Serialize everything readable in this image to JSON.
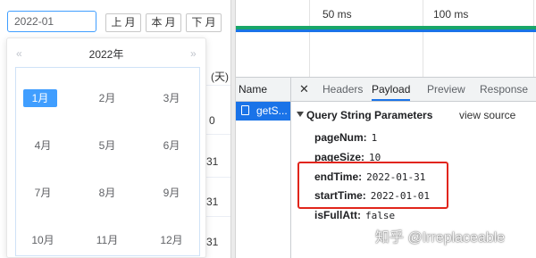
{
  "month_filter": {
    "value": "2022-01",
    "prev_month_label": "上 月",
    "this_month_label": "本 月",
    "next_month_label": "下 月"
  },
  "month_picker": {
    "prev_year_glyph": "«",
    "next_year_glyph": "»",
    "year_label": "2022年",
    "selected": "1月",
    "months": [
      "1月",
      "2月",
      "3月",
      "4月",
      "5月",
      "6月",
      "7月",
      "8月",
      "9月",
      "10月",
      "11月",
      "12月"
    ]
  },
  "background_table": {
    "header_partial": "(天)",
    "cells_partial": [
      "0",
      "31",
      "31",
      "31",
      "31"
    ]
  },
  "devtools": {
    "timeline_ticks": [
      "50 ms",
      "100 ms"
    ],
    "name_header": "Name",
    "request_name": "getS...",
    "close_glyph": "✕",
    "tabs": [
      "Headers",
      "Payload",
      "Preview",
      "Response"
    ],
    "active_tab": "Payload",
    "section_title": "Query String Parameters",
    "view_source_label": "view source",
    "params": [
      {
        "key": "pageNum:",
        "value": "1"
      },
      {
        "key": "pageSize:",
        "value": "10"
      },
      {
        "key": "endTime:",
        "value": "2022-01-31"
      },
      {
        "key": "startTime:",
        "value": "2022-01-01"
      },
      {
        "key": "isFullAtt:",
        "value": "false"
      }
    ]
  },
  "watermark": "知乎 @Irreplaceable",
  "colors": {
    "accent": "#409eff",
    "devtools_blue": "#1a73e8",
    "waterfall_green": "#19a669",
    "highlight_red": "#e1251b"
  }
}
